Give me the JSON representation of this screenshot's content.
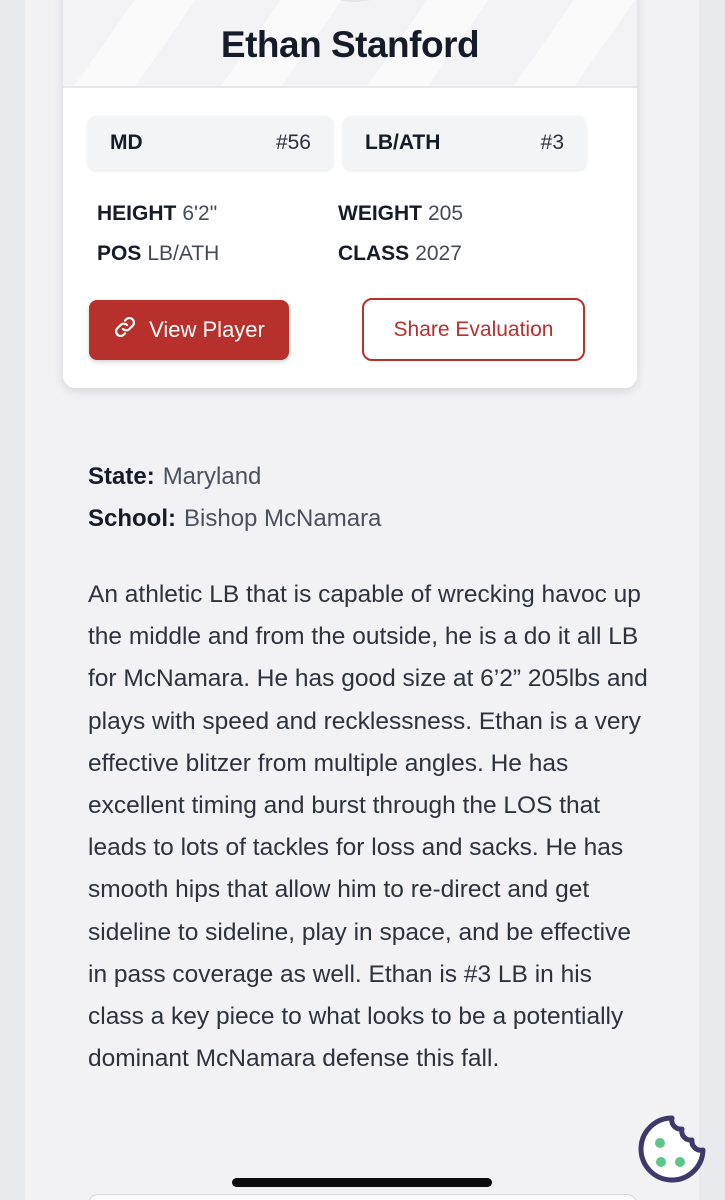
{
  "player": {
    "name": "Ethan Stanford",
    "state_code": "MD",
    "state_rank": "#56",
    "position_code": "LB/ATH",
    "position_rank": "#3",
    "stats": {
      "height_label": "HEIGHT",
      "height_value": "6'2\"",
      "weight_label": "WEIGHT",
      "weight_value": "205",
      "pos_label": "POS",
      "pos_value": "LB/ATH",
      "class_label": "CLASS",
      "class_value": "2027"
    }
  },
  "actions": {
    "view_label": "View Player",
    "share_label": "Share Evaluation"
  },
  "details": {
    "state_label": "State:",
    "state_value": "Maryland",
    "school_label": "School:",
    "school_value": "Bishop McNamara"
  },
  "evaluation": {
    "text": "An athletic LB that is capable of wrecking havoc up the middle and from the outside, he is a do it all LB for McNamara. He has good size at 6’2” 205lbs and plays with speed and recklessness. Ethan is a very effective blitzer from multiple angles. He has excellent timing and burst through the LOS that leads to lots of tackles for loss and sacks. He has smooth hips that allow him to re-direct and get sideline to sideline, play in space, and be effective in pass coverage as well. Ethan is #3 LB in his class a key piece to what looks to be a potentially dominant McNamara defense this fall."
  },
  "colors": {
    "accent": "#b8302c",
    "cookie": "#3d3a6b",
    "cookie_dots": "#5cc58a"
  },
  "icons": {
    "view": "link-icon",
    "cookie": "cookie-icon"
  }
}
